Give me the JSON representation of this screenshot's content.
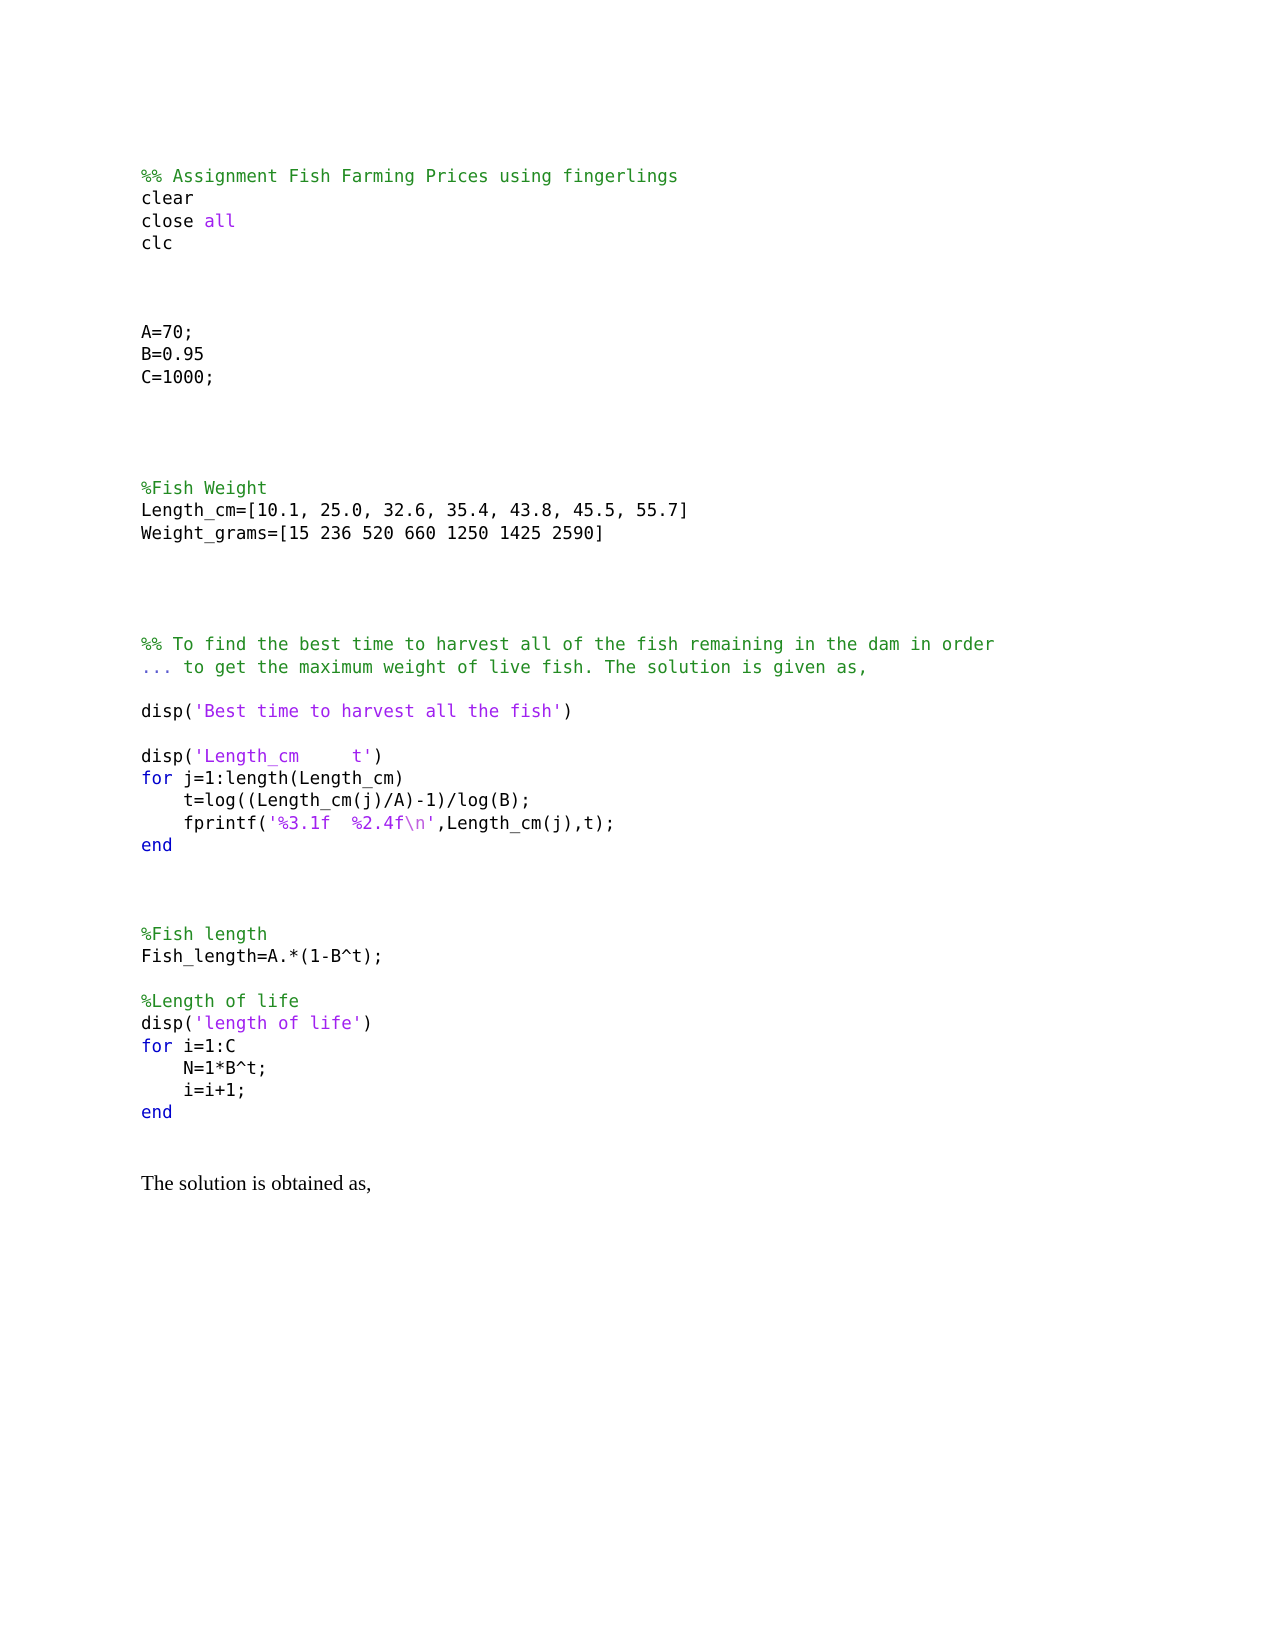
{
  "document": {
    "type": "matlab-code-listing",
    "colors": {
      "comment": "#228B22",
      "string": "#A020F0",
      "keyword": "#0000CD",
      "escape": "#C060E0",
      "plain": "#000000",
      "background": "#ffffff"
    }
  },
  "code": {
    "lines": [
      {
        "id": "l01",
        "segments": [
          {
            "cls": "cm",
            "text": "%% Assignment Fish Farming Prices using fingerlings"
          }
        ]
      },
      {
        "id": "l02",
        "segments": [
          {
            "cls": "pl",
            "text": "clear"
          }
        ]
      },
      {
        "id": "l03",
        "segments": [
          {
            "cls": "pl",
            "text": "close "
          },
          {
            "cls": "str",
            "text": "all"
          }
        ]
      },
      {
        "id": "l04",
        "segments": [
          {
            "cls": "pl",
            "text": "clc"
          }
        ]
      },
      {
        "id": "l05",
        "segments": [
          {
            "cls": "pl",
            "text": ""
          }
        ]
      },
      {
        "id": "l06",
        "segments": [
          {
            "cls": "pl",
            "text": ""
          }
        ]
      },
      {
        "id": "l07",
        "segments": [
          {
            "cls": "pl",
            "text": ""
          }
        ]
      },
      {
        "id": "l08",
        "segments": [
          {
            "cls": "pl",
            "text": "A=70;"
          }
        ]
      },
      {
        "id": "l09",
        "segments": [
          {
            "cls": "pl",
            "text": "B=0.95"
          }
        ]
      },
      {
        "id": "l10",
        "segments": [
          {
            "cls": "pl",
            "text": "C=1000;"
          }
        ]
      },
      {
        "id": "l11",
        "segments": [
          {
            "cls": "pl",
            "text": ""
          }
        ]
      },
      {
        "id": "l12",
        "segments": [
          {
            "cls": "pl",
            "text": ""
          }
        ]
      },
      {
        "id": "l13",
        "segments": [
          {
            "cls": "pl",
            "text": ""
          }
        ]
      },
      {
        "id": "l14",
        "segments": [
          {
            "cls": "pl",
            "text": ""
          }
        ]
      },
      {
        "id": "l15",
        "segments": [
          {
            "cls": "cm",
            "text": "%Fish Weight"
          }
        ]
      },
      {
        "id": "l16",
        "segments": [
          {
            "cls": "pl",
            "text": "Length_cm=[10.1, 25.0, 32.6, 35.4, 43.8, 45.5, 55.7]"
          }
        ]
      },
      {
        "id": "l17",
        "segments": [
          {
            "cls": "pl",
            "text": "Weight_grams=[15 236 520 660 1250 1425 2590]"
          }
        ]
      },
      {
        "id": "l18",
        "segments": [
          {
            "cls": "pl",
            "text": ""
          }
        ]
      },
      {
        "id": "l19",
        "segments": [
          {
            "cls": "pl",
            "text": ""
          }
        ]
      },
      {
        "id": "l20",
        "segments": [
          {
            "cls": "pl",
            "text": ""
          }
        ]
      },
      {
        "id": "l21",
        "segments": [
          {
            "cls": "pl",
            "text": ""
          }
        ]
      },
      {
        "id": "l22",
        "segments": [
          {
            "cls": "cm",
            "text": "%% To find the best time to harvest all of the fish remaining in the dam in order"
          }
        ]
      },
      {
        "id": "l23",
        "segments": [
          {
            "cls": "cont",
            "text": "... "
          },
          {
            "cls": "cm",
            "text": "to get the maximum weight of live fish. The solution is given as,"
          }
        ]
      },
      {
        "id": "l24",
        "segments": [
          {
            "cls": "pl",
            "text": ""
          }
        ]
      },
      {
        "id": "l25",
        "segments": [
          {
            "cls": "pl",
            "text": "disp("
          },
          {
            "cls": "str",
            "text": "'Best time to harvest all the fish'"
          },
          {
            "cls": "pl",
            "text": ")"
          }
        ]
      },
      {
        "id": "l26",
        "segments": [
          {
            "cls": "pl",
            "text": ""
          }
        ]
      },
      {
        "id": "l27",
        "segments": [
          {
            "cls": "pl",
            "text": "disp("
          },
          {
            "cls": "str",
            "text": "'Length_cm     t'"
          },
          {
            "cls": "pl",
            "text": ")"
          }
        ]
      },
      {
        "id": "l28",
        "segments": [
          {
            "cls": "kw",
            "text": "for"
          },
          {
            "cls": "pl",
            "text": " j=1:length(Length_cm)"
          }
        ]
      },
      {
        "id": "l29",
        "segments": [
          {
            "cls": "pl",
            "text": "    t=log((Length_cm(j)/A)-1)/log(B);"
          }
        ]
      },
      {
        "id": "l30",
        "segments": [
          {
            "cls": "pl",
            "text": "    fprintf("
          },
          {
            "cls": "str",
            "text": "'%3.1f  %2.4f"
          },
          {
            "cls": "esc",
            "text": "\\n"
          },
          {
            "cls": "str",
            "text": "'"
          },
          {
            "cls": "pl",
            "text": ",Length_cm(j),t);"
          }
        ]
      },
      {
        "id": "l31",
        "segments": [
          {
            "cls": "kw",
            "text": "end"
          }
        ]
      },
      {
        "id": "l32",
        "segments": [
          {
            "cls": "pl",
            "text": ""
          }
        ]
      },
      {
        "id": "l33",
        "segments": [
          {
            "cls": "pl",
            "text": ""
          }
        ]
      },
      {
        "id": "l34",
        "segments": [
          {
            "cls": "pl",
            "text": ""
          }
        ]
      },
      {
        "id": "l35",
        "segments": [
          {
            "cls": "cm",
            "text": "%Fish length"
          }
        ]
      },
      {
        "id": "l36",
        "segments": [
          {
            "cls": "pl",
            "text": "Fish_length=A.*(1-B^t);"
          }
        ]
      },
      {
        "id": "l37",
        "segments": [
          {
            "cls": "pl",
            "text": ""
          }
        ]
      },
      {
        "id": "l38",
        "segments": [
          {
            "cls": "cm",
            "text": "%Length of life"
          }
        ]
      },
      {
        "id": "l39",
        "segments": [
          {
            "cls": "pl",
            "text": "disp("
          },
          {
            "cls": "str",
            "text": "'length of life'"
          },
          {
            "cls": "pl",
            "text": ")"
          }
        ]
      },
      {
        "id": "l40",
        "segments": [
          {
            "cls": "kw",
            "text": "for"
          },
          {
            "cls": "pl",
            "text": " i=1:C"
          }
        ]
      },
      {
        "id": "l41",
        "segments": [
          {
            "cls": "pl",
            "text": "    N=1*B^t;"
          }
        ]
      },
      {
        "id": "l42",
        "segments": [
          {
            "cls": "pl",
            "text": "    i=i+1;"
          }
        ]
      },
      {
        "id": "l43",
        "segments": [
          {
            "cls": "kw",
            "text": "end"
          }
        ]
      }
    ]
  },
  "prose": {
    "solution_sentence": "The solution is obtained as,"
  }
}
